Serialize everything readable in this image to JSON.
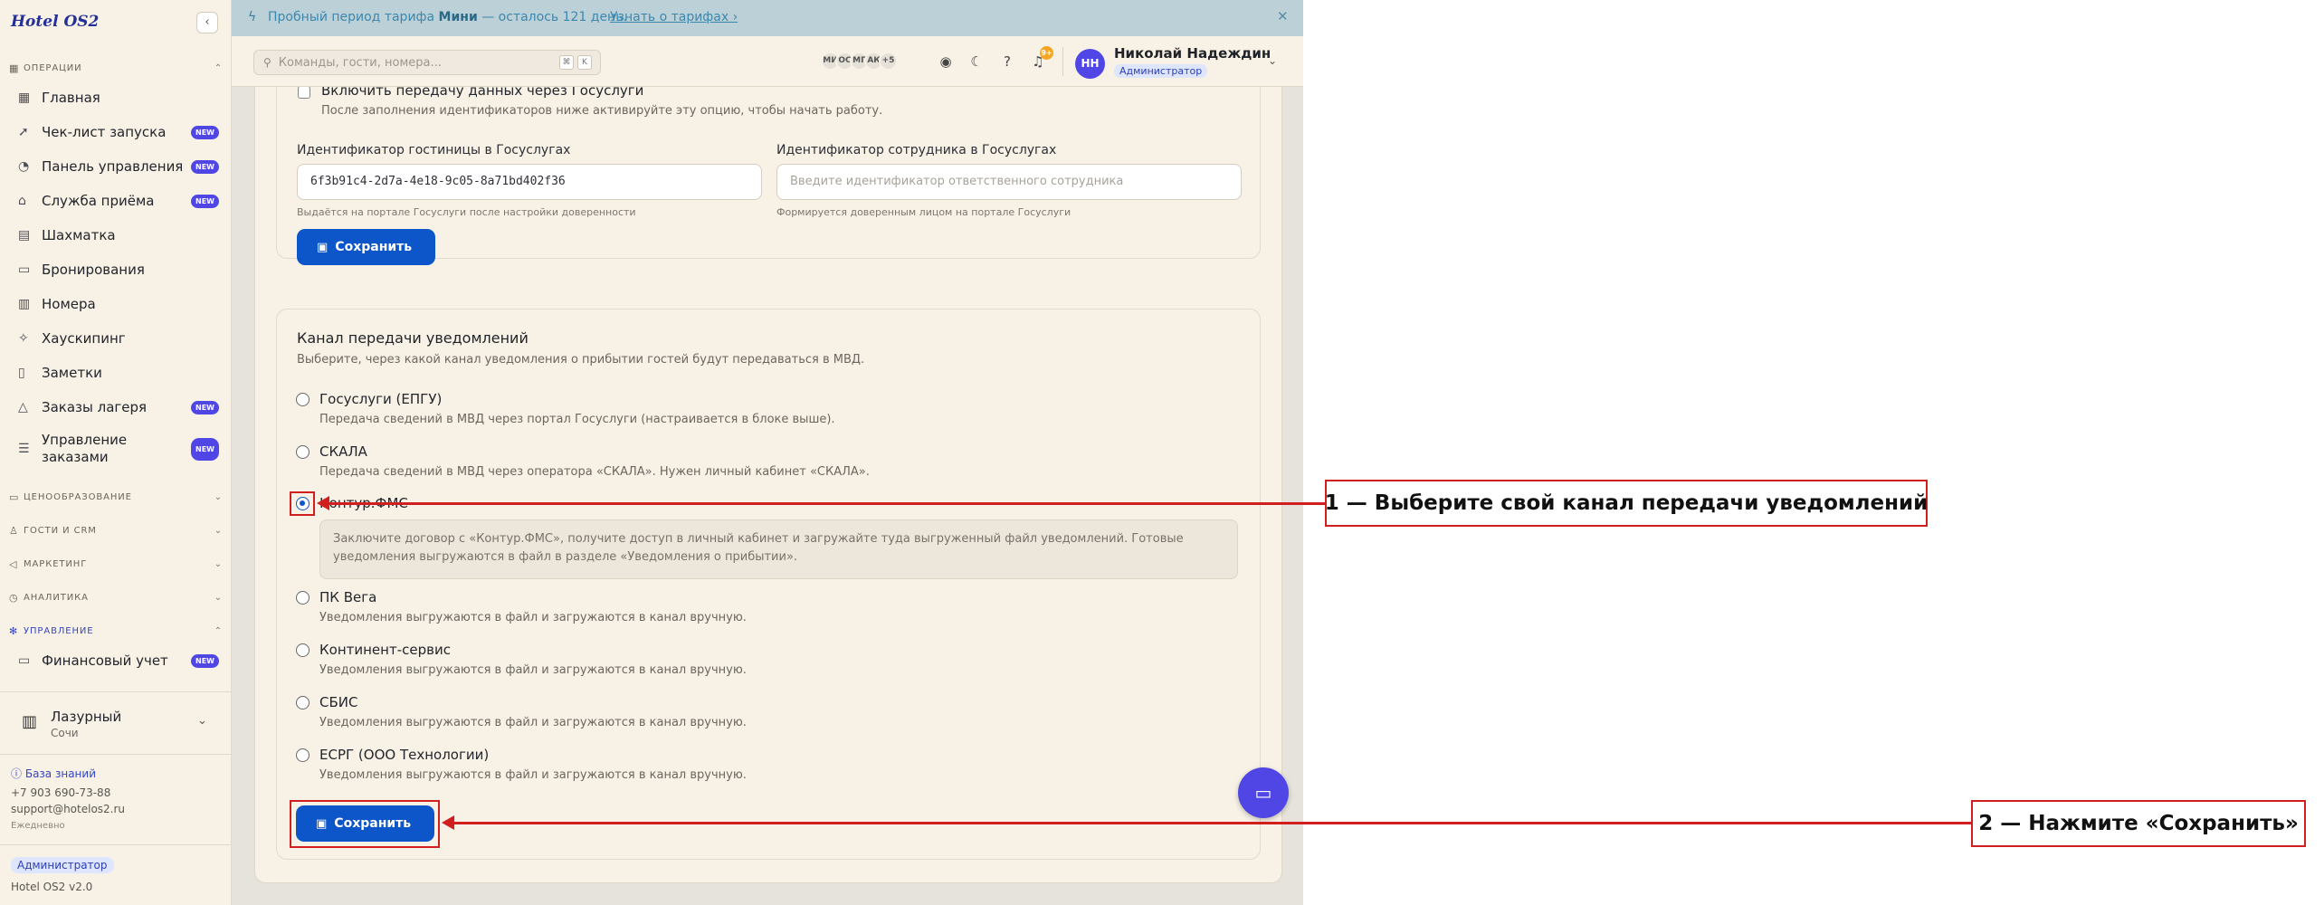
{
  "sidebar": {
    "brand": "Hotel OS2",
    "groups": {
      "operations": "ОПЕРАЦИИ",
      "pricing": "ЦЕНООБРАЗОВАНИЕ",
      "guests": "ГОСТИ И CRM",
      "marketing": "МАРКЕТИНГ",
      "analytics": "АНАЛИТИКА",
      "management": "УПРАВЛЕНИЕ"
    },
    "items": [
      {
        "label": "Главная"
      },
      {
        "label": "Чек-лист запуска",
        "badge": "NEW"
      },
      {
        "label": "Панель управления",
        "badge": "NEW"
      },
      {
        "label": "Служба приёма",
        "badge": "NEW"
      },
      {
        "label": "Шахматка"
      },
      {
        "label": "Бронирования"
      },
      {
        "label": "Номера"
      },
      {
        "label": "Хаускипинг"
      },
      {
        "label": "Заметки"
      },
      {
        "label": "Заказы лагеря",
        "badge": "NEW"
      },
      {
        "label": "Управление заказами",
        "badge": "NEW"
      },
      {
        "label": "Финансовый учет",
        "badge": "NEW"
      }
    ],
    "property": {
      "name": "Лазурный",
      "city": "Сочи"
    },
    "knowledge_base": "База знаний",
    "phone": "+7 903 690-73-88",
    "email": "support@hotelos2.ru",
    "daily": "Ежедневно",
    "role": "Администратор",
    "version": "Hotel OS2 v2.0"
  },
  "trial": {
    "text_before": "Пробный период тарифа",
    "plan": "Мини",
    "text_after": "— осталось 121 день.",
    "link": "Узнать о тарифах ›"
  },
  "header": {
    "search_placeholder": "Команды, гости, номера...",
    "kbd1": "⌘",
    "kbd2": "K",
    "avatars": [
      "МИ",
      "ОС",
      "МГ",
      "АК"
    ],
    "more_avatars": "+5",
    "notifications_badge": "9+",
    "user_initials": "НН",
    "user_name": "Николай Надеждин",
    "user_role": "Администратор"
  },
  "gosuslugi": {
    "checkbox_label": "Включить передачу данных через Госуслуги",
    "checkbox_hint": "После заполнения идентификаторов ниже активируйте эту опцию, чтобы начать работу.",
    "hotel_id_label": "Идентификатор гостиницы в Госуслугах",
    "hotel_id_value": "6f3b91c4-2d7a-4e18-9c05-8a71bd402f36",
    "hotel_id_hint": "Выдаётся на портале Госуслуги после настройки доверенности",
    "employee_id_label": "Идентификатор сотрудника в Госуслугах",
    "employee_id_placeholder": "Введите идентификатор ответственного сотрудника",
    "employee_id_hint": "Формируется доверенным лицом на портале Госуслуги",
    "save": "Сохранить"
  },
  "channel": {
    "title": "Канал передачи уведомлений",
    "subtitle": "Выберите, через какой канал уведомления о прибытии гостей будут передаваться в МВД.",
    "options": [
      {
        "label": "Госуслуги (ЕПГУ)",
        "desc": "Передача сведений в МВД через портал Госуслуги (настраивается в блоке выше).",
        "checked": false
      },
      {
        "label": "СКАЛА",
        "desc": "Передача сведений в МВД через оператора «СКАЛА». Нужен личный кабинет «СКАЛА».",
        "checked": false
      },
      {
        "label": "Контур.ФМС",
        "desc": "Заключите договор с «Контур.ФМС», получите доступ в личный кабинет и загружайте туда выгруженный файл уведомлений. Готовые уведомления выгружаются в файл в разделе «Уведомления о прибытии».",
        "checked": true
      },
      {
        "label": "ПК Вега",
        "desc": "Уведомления выгружаются в файл и загружаются в канал вручную.",
        "checked": false
      },
      {
        "label": "Континент-сервис",
        "desc": "Уведомления выгружаются в файл и загружаются в канал вручную.",
        "checked": false
      },
      {
        "label": "СБИС",
        "desc": "Уведомления выгружаются в файл и загружаются в канал вручную.",
        "checked": false
      },
      {
        "label": "ЕСРГ (ООО Технологии)",
        "desc": "Уведомления выгружаются в файл и загружаются в канал вручную.",
        "checked": false
      }
    ],
    "save": "Сохранить"
  },
  "annotations": {
    "step1": "1 — Выберите свой канал передачи уведомлений",
    "step2": "2 — Нажмите «Сохранить»",
    "color": "#d11f1f"
  },
  "colors": {
    "accent": "#0d56c9",
    "brand": "#4f46e5",
    "sidebar_bg": "#f7f1e6",
    "trial_bg": "#bcd0d8"
  }
}
